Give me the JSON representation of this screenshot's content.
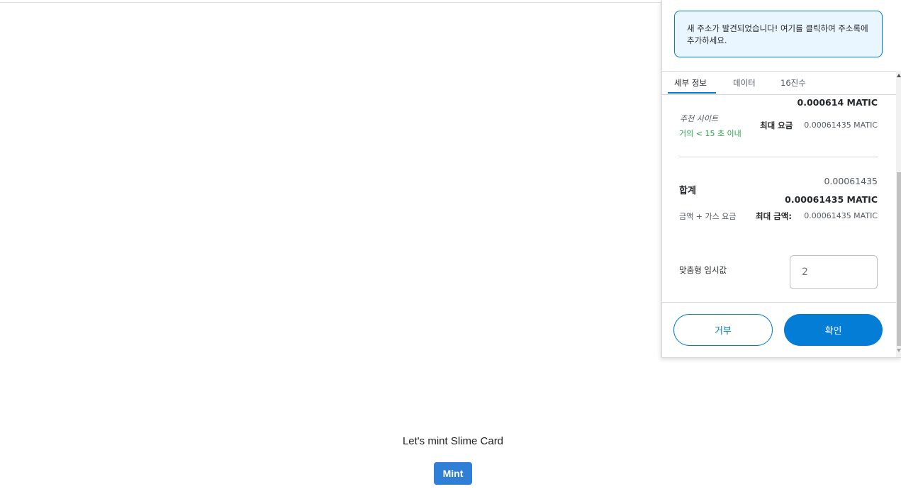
{
  "page": {
    "heading": "Let's mint Slime Card",
    "mint_label": "Mint"
  },
  "popup": {
    "notice": "새 주소가 발견되었습니다! 여기를 클릭하여 주소록에 추가하세요.",
    "tabs": [
      {
        "label": "세부 정보",
        "active": true
      },
      {
        "label": "데이터",
        "active": false
      },
      {
        "label": "16진수",
        "active": false
      }
    ],
    "gas": {
      "amount": "0.000614 MATIC",
      "estimate_label": "추천 사이트",
      "timing": "거의 < 15 초 이내",
      "max_fee_label": "최대 요금",
      "max_fee_value": "0.00061435 MATIC"
    },
    "total": {
      "label": "합계",
      "value_plain": "0.00061435",
      "value": "0.00061435 MATIC",
      "sub_label": "금액 + 가스 요금",
      "max_amount_label": "최대 금액:",
      "max_amount_value": "0.00061435 MATIC"
    },
    "nonce": {
      "label": "맞춤형 임시값",
      "placeholder": "2"
    },
    "buttons": {
      "reject": "거부",
      "confirm": "확인"
    }
  },
  "colors": {
    "accent": "#037dd6",
    "mint_button": "#2f7fd6",
    "success": "#28a745",
    "notice_bg": "#eaf6ff"
  }
}
